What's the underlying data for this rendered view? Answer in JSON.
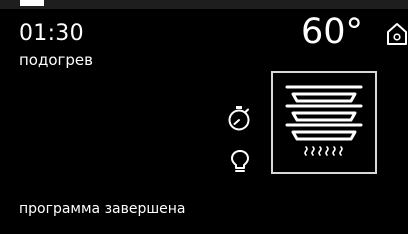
{
  "display": {
    "time": "01:30",
    "mode_label": "подогрев",
    "temperature": "60°",
    "status_message": "программа завершена"
  },
  "icons": {
    "home": "home-icon",
    "timer": "timer-icon",
    "light": "oven-light-icon",
    "program": "multi-level-steam-trays-icon"
  },
  "colors": {
    "background": "#000000",
    "text": "#ffffff",
    "tile_border": "#d8d8d8"
  }
}
